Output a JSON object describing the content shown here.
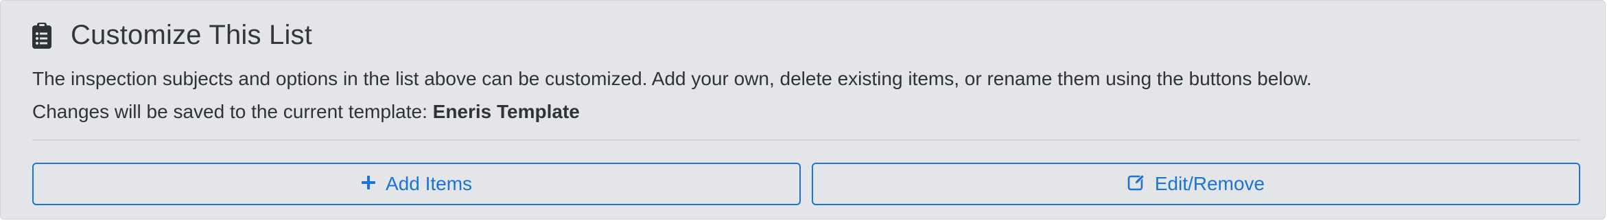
{
  "section": {
    "title": "Customize This List",
    "icon": "clipboard-list-icon",
    "description": "The inspection subjects and options in the list above can be customized. Add your own, delete existing items, or rename them using the buttons below.",
    "save_prefix": "Changes will be saved to the current template: ",
    "template_name": "Eneris Template"
  },
  "buttons": {
    "add_label": "Add Items",
    "add_icon": "plus-icon",
    "edit_label": "Edit/Remove",
    "edit_icon": "edit-icon"
  },
  "colors": {
    "panel_bg": "#e4e5e8",
    "accent": "#1a73d9",
    "text": "#2f3237"
  }
}
